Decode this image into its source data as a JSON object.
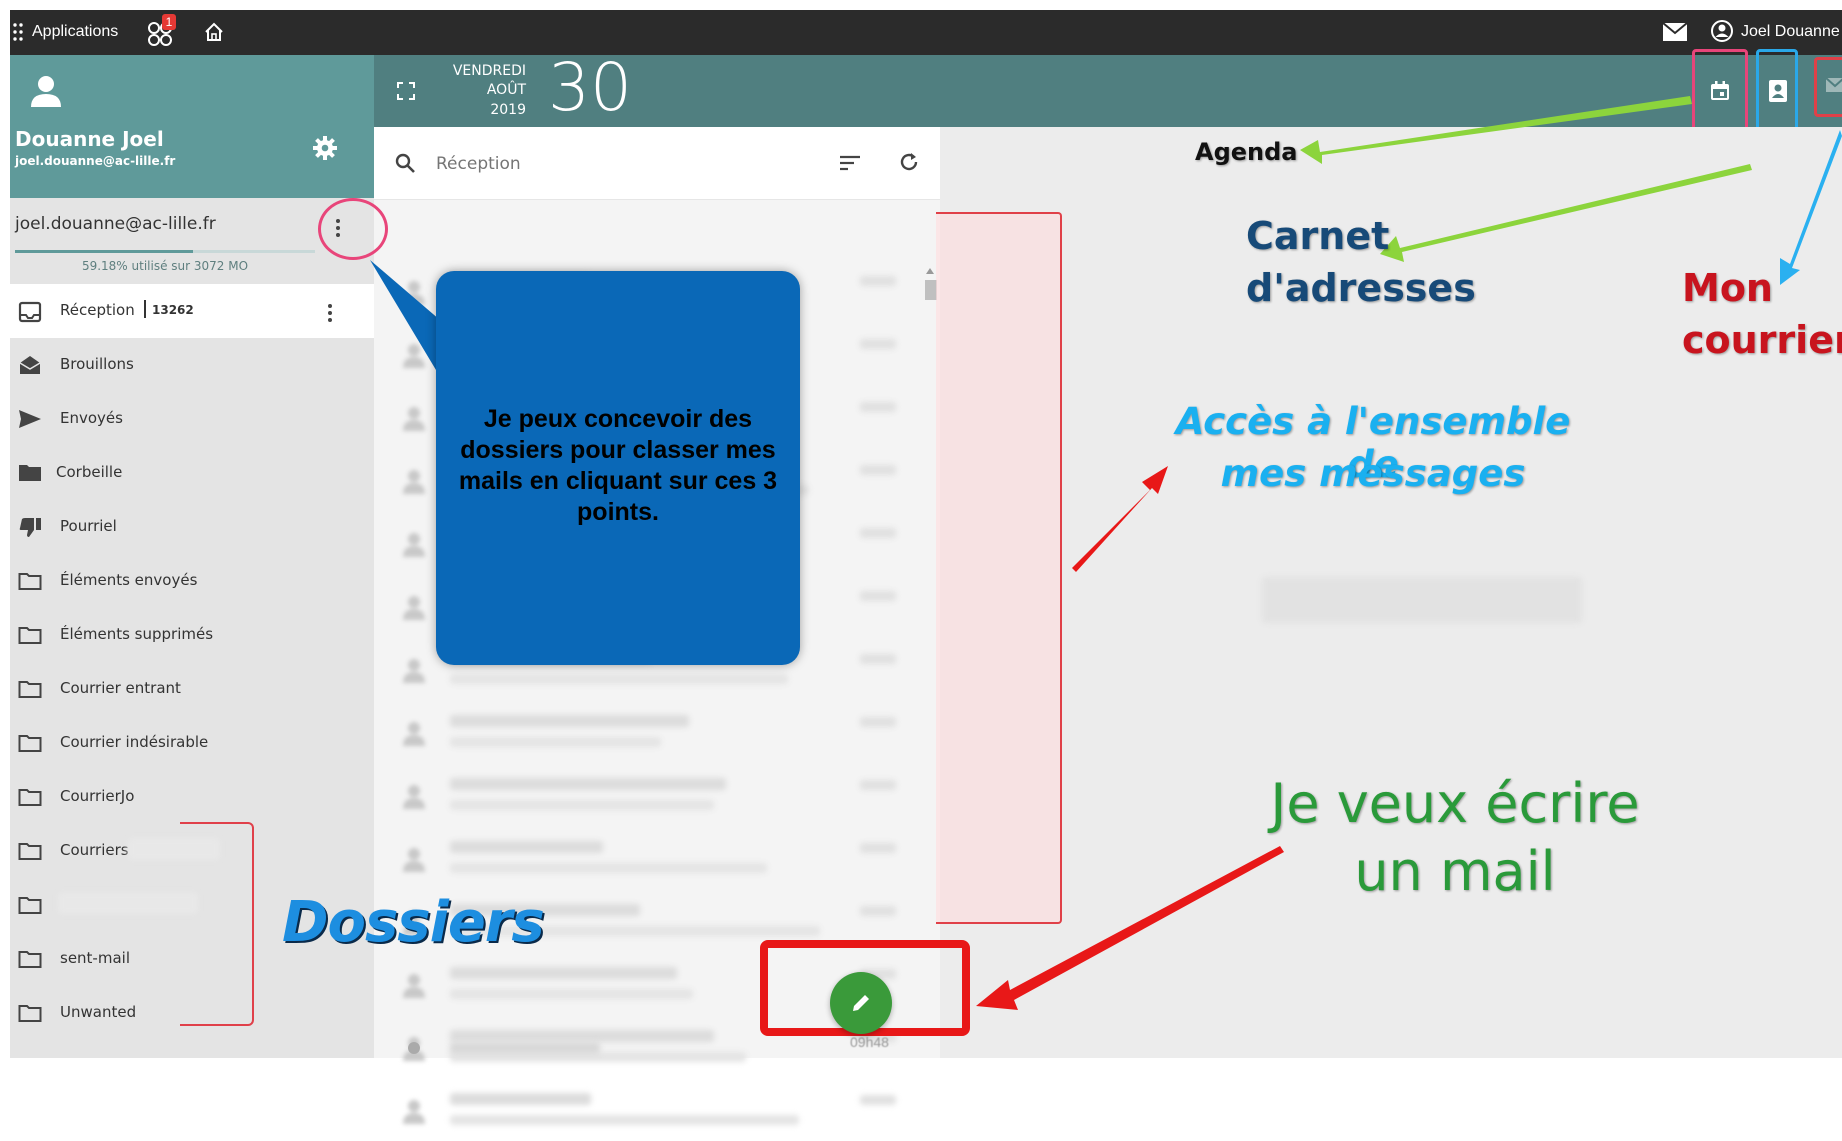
{
  "topbar": {
    "apps_label": "Applications",
    "notif_count": "1",
    "user_name": "Joel Douanne"
  },
  "profile": {
    "name": "Douanne Joel",
    "email": "joel.douanne@ac-lille.fr"
  },
  "account": {
    "email": "joel.douanne@ac-lille.fr",
    "quota": "59.18% utilisé sur 3072 MO",
    "quota_fraction": 0.5918
  },
  "date": {
    "weekday": "VENDREDI",
    "month": "AOÛT",
    "year": "2019",
    "day": "30"
  },
  "inbox": {
    "label": "Réception",
    "count": "13262"
  },
  "folders": [
    {
      "label": "Brouillons",
      "icon": "drafts-icon"
    },
    {
      "label": "Envoyés",
      "icon": "send-icon"
    },
    {
      "label": "Corbeille",
      "icon": "trash-folder-icon"
    },
    {
      "label": "Pourriel",
      "icon": "thumbs-down-icon"
    },
    {
      "label": "Éléments envoyés",
      "icon": "folder-icon"
    },
    {
      "label": "Éléments supprimés",
      "icon": "folder-icon"
    },
    {
      "label": "Courrier entrant",
      "icon": "folder-icon"
    },
    {
      "label": "Courrier indésirable",
      "icon": "folder-icon"
    },
    {
      "label": "CourrierJo",
      "icon": "folder-icon"
    },
    {
      "label": "Courriers",
      "icon": "folder-icon"
    },
    {
      "label": "",
      "icon": "folder-icon"
    },
    {
      "label": "sent-mail",
      "icon": "folder-icon"
    },
    {
      "label": "Unwanted",
      "icon": "folder-icon"
    }
  ],
  "search": {
    "placeholder": "Réception"
  },
  "list": {
    "time_bottom": "09h48"
  },
  "annotations": {
    "callout": "Je peux concevoir des dossiers pour classer mes mails en cliquant sur ces 3 points.",
    "agenda": "Agenda",
    "carnet_1": "Carnet",
    "carnet_2": "d'adresses",
    "mon": "Mon",
    "courrier": "courrier",
    "acces_1": "Accès à l'ensemble de",
    "acces_2": "mes messages",
    "ecrire_1": "Je veux écrire",
    "ecrire_2": "un mail",
    "dossiers": "Dossiers"
  },
  "colors": {
    "teal_header": "#507f80",
    "teal_profile": "#5f9a9a",
    "fab_green": "#3a9a3a",
    "callout_blue": "#0a68b7"
  }
}
